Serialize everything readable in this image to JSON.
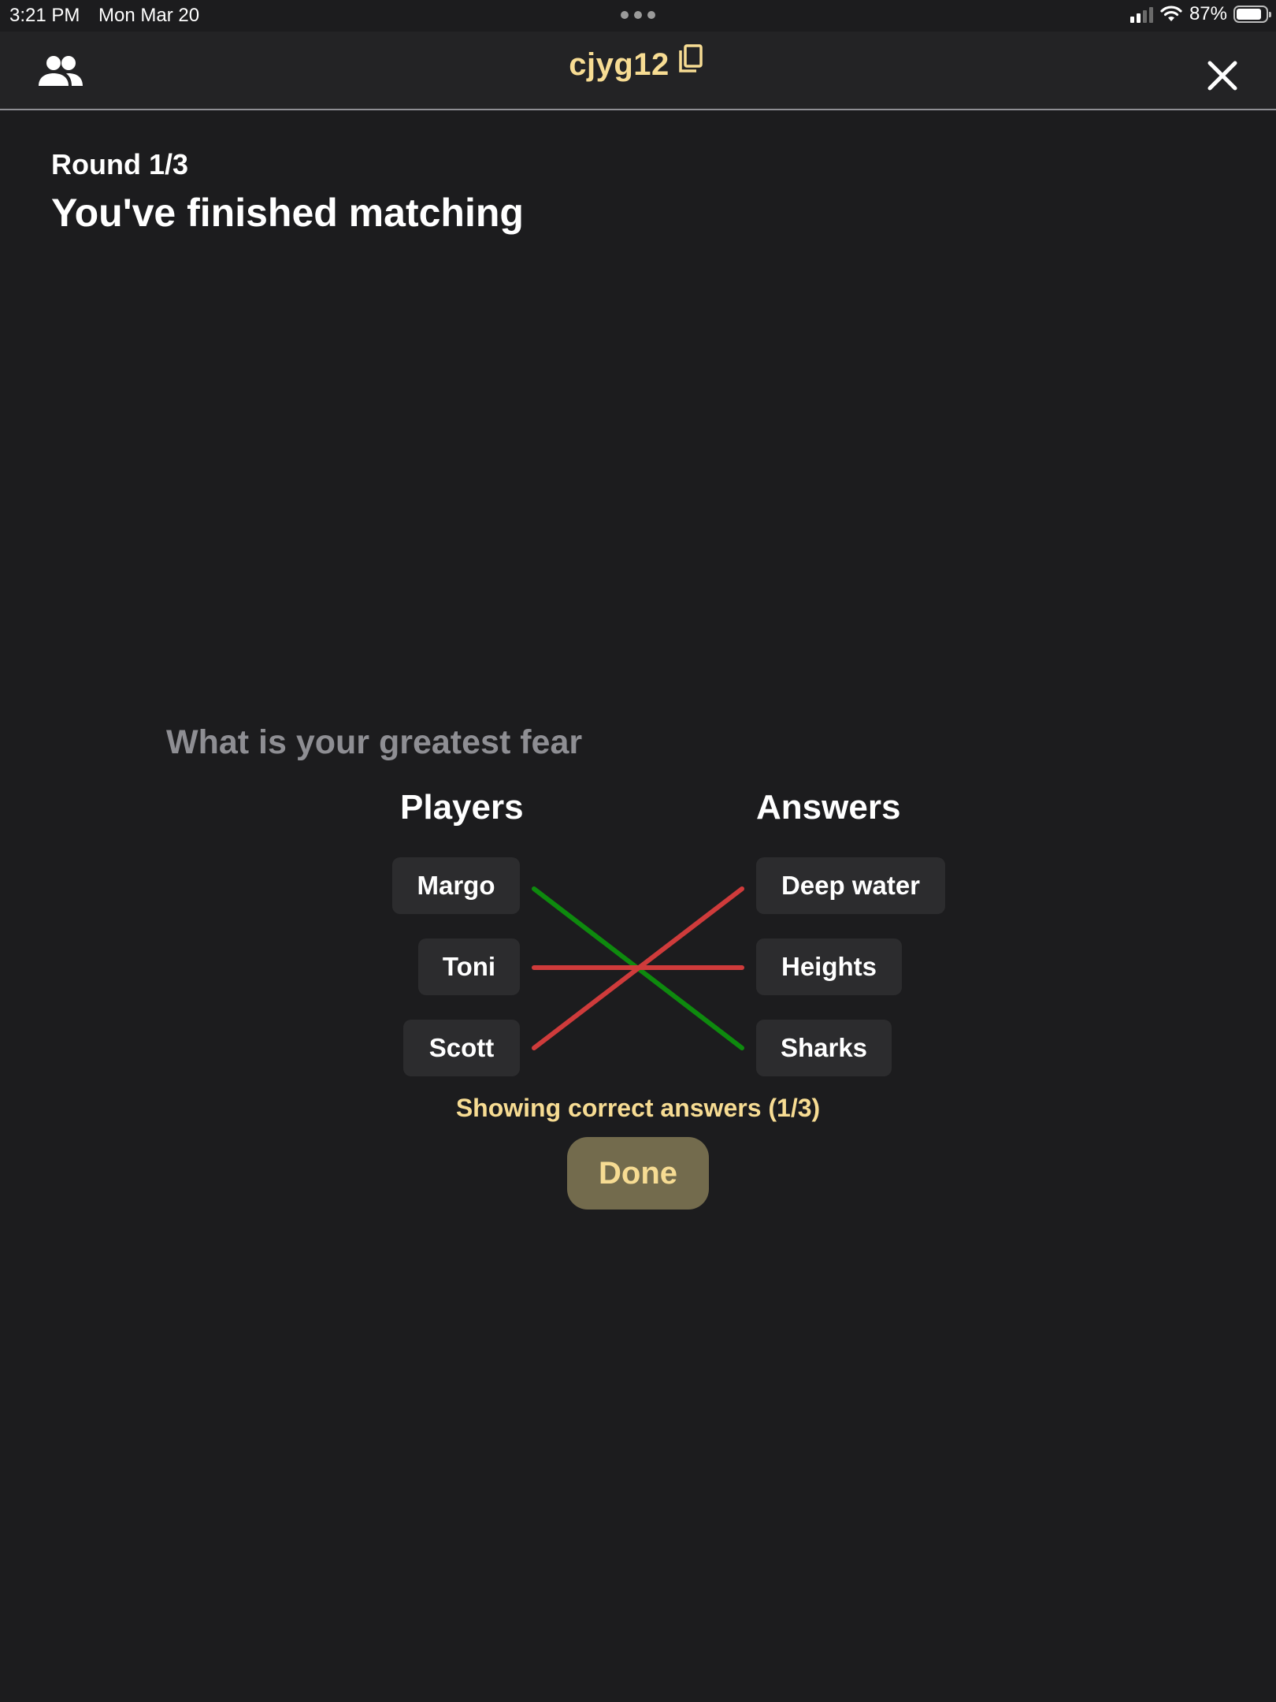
{
  "status_bar": {
    "time": "3:21 PM",
    "date": "Mon Mar 20",
    "battery": "87%",
    "battery_level": 0.87
  },
  "header": {
    "room_code": "cjyg12",
    "icons": {
      "left": "players-icon",
      "copy": "copy-icon",
      "right": "close-icon"
    }
  },
  "round": {
    "label": "Round 1/3",
    "title": "You've finished matching"
  },
  "question": "What is your greatest fear",
  "matching": {
    "players_header": "Players",
    "answers_header": "Answers",
    "players": [
      "Margo",
      "Toni",
      "Scott"
    ],
    "answers": [
      "Deep water",
      "Heights",
      "Sharks"
    ],
    "links": [
      {
        "player": "Margo",
        "answer": "Sharks",
        "correct": true
      },
      {
        "player": "Toni",
        "answer": "Heights",
        "correct": false
      },
      {
        "player": "Scott",
        "answer": "Deep water",
        "correct": false
      }
    ],
    "result_text": "Showing correct answers (1/3)"
  },
  "done_label": "Done",
  "colors": {
    "background": "#1c1c1e",
    "accent": "#f7dc93",
    "correct": "#0e8a0e",
    "incorrect": "#cf3b3b",
    "muted": "#8e8e93"
  }
}
